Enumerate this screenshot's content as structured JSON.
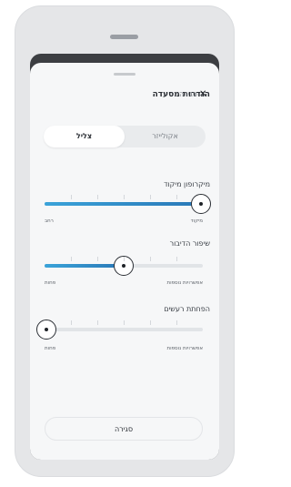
{
  "sheet": {
    "title": "הגדרות מסעדה",
    "close_link": "סגירה",
    "close_icon": "close-icon"
  },
  "mode": {
    "options": [
      "צליל",
      "אקולייזר"
    ],
    "selected": "צליל"
  },
  "sliders": [
    {
      "title": "מיקרופון מיקוד",
      "value": 1.0,
      "min_label": "רחב",
      "max_label": "מיקוד"
    },
    {
      "title": "שיפור הדיבור",
      "value": 0.5,
      "min_label": "פחות",
      "max_label": "אפשרויות נוספות"
    },
    {
      "title": "הפחתת רעשים",
      "value": 0.0,
      "min_label": "פחות",
      "max_label": "אפשרויות נוספות"
    }
  ],
  "footer": {
    "close_button": "סגירה"
  },
  "colors": {
    "accent_start": "#3aa3d9",
    "accent_end": "#2978b7"
  }
}
